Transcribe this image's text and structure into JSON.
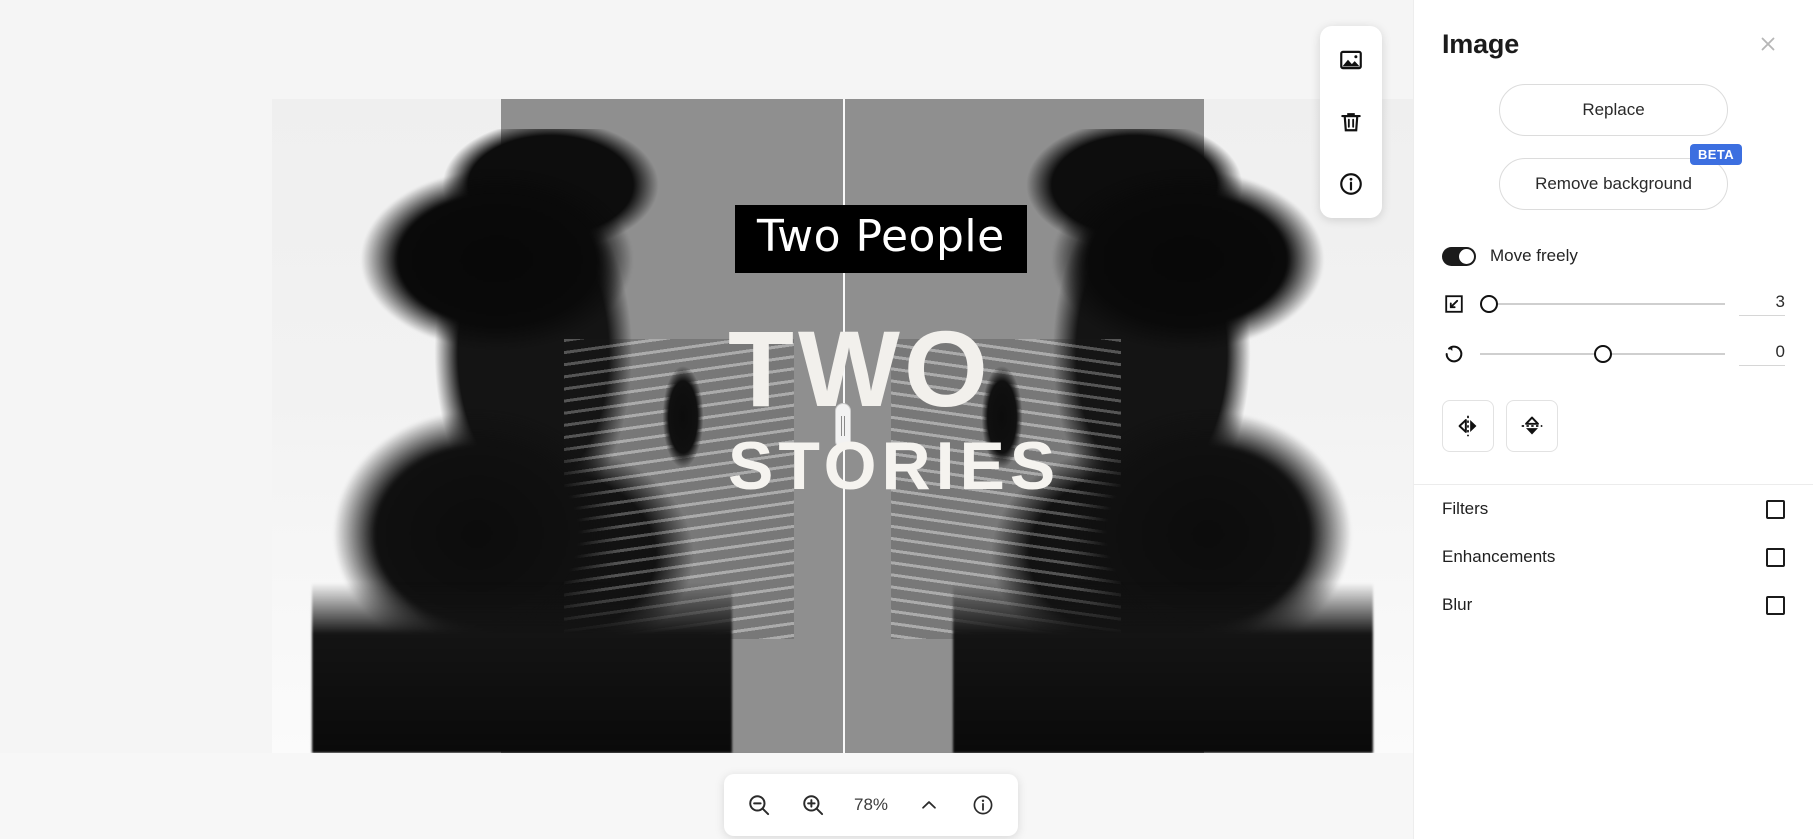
{
  "canvas": {
    "overlays": {
      "badge_text": "Two People",
      "headline_line1": "TWO",
      "headline_line2": "STORIES"
    },
    "float_toolbar": {
      "items": [
        {
          "name": "image-icon",
          "tooltip": "Image"
        },
        {
          "name": "trash-icon",
          "tooltip": "Delete"
        },
        {
          "name": "info-icon",
          "tooltip": "Info"
        }
      ]
    },
    "zoom_bar": {
      "zoom_out_icon": "zoom-out-icon",
      "zoom_in_icon": "zoom-in-icon",
      "zoom_level": "78%",
      "chevron_icon": "chevron-up-icon",
      "info_icon": "info-icon"
    }
  },
  "panel": {
    "title": "Image",
    "close_icon": "close-icon",
    "replace_label": "Replace",
    "remove_background_label": "Remove background",
    "beta_badge": "BETA",
    "beta_color": "#3c6fe0",
    "move_freely": {
      "label": "Move freely",
      "enabled": true
    },
    "sliders": [
      {
        "icon": "resize-icon",
        "value": "3"
      },
      {
        "icon": "rotate-counterclockwise-icon",
        "value": "0"
      }
    ],
    "flip_buttons": [
      {
        "icon": "flip-horizontal-icon"
      },
      {
        "icon": "flip-vertical-icon"
      }
    ],
    "accordions": [
      {
        "label": "Filters",
        "checkbox": "square-outline-icon"
      },
      {
        "label": "Enhancements",
        "checkbox": "square-outline-icon"
      },
      {
        "label": "Blur",
        "checkbox": "square-outline-icon"
      }
    ]
  }
}
